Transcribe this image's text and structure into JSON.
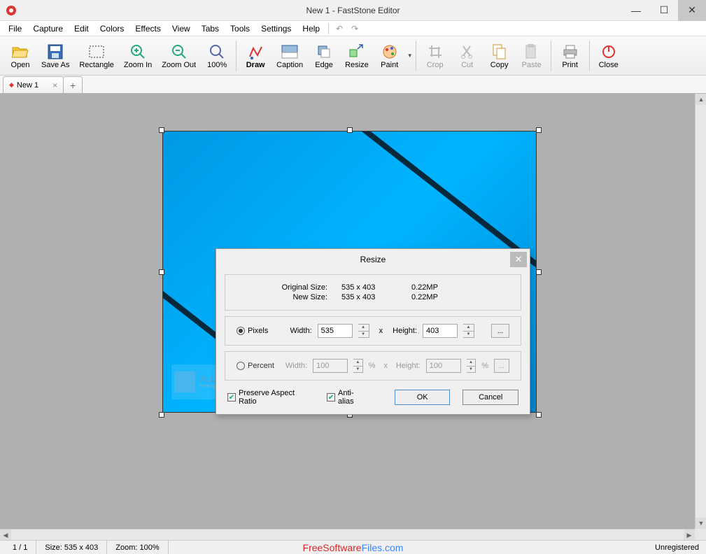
{
  "window": {
    "title": "New 1 - FastStone Editor"
  },
  "menu": [
    "File",
    "Capture",
    "Edit",
    "Colors",
    "Effects",
    "View",
    "Tabs",
    "Tools",
    "Settings",
    "Help"
  ],
  "toolbar": [
    {
      "label": "Open",
      "icon": "open-icon",
      "enabled": true
    },
    {
      "label": "Save As",
      "icon": "save-icon",
      "enabled": true
    },
    {
      "label": "Rectangle",
      "icon": "rect-icon",
      "enabled": true
    },
    {
      "label": "Zoom In",
      "icon": "zoomin-icon",
      "enabled": true
    },
    {
      "label": "Zoom Out",
      "icon": "zoomout-icon",
      "enabled": true
    },
    {
      "label": "100%",
      "icon": "zoom100-icon",
      "enabled": true
    }
  ],
  "toolbar2": [
    {
      "label": "Draw",
      "icon": "draw-icon",
      "bold": true,
      "enabled": true
    },
    {
      "label": "Caption",
      "icon": "caption-icon",
      "enabled": true
    },
    {
      "label": "Edge",
      "icon": "edge-icon",
      "enabled": true
    },
    {
      "label": "Resize",
      "icon": "resize-icon",
      "enabled": true
    },
    {
      "label": "Paint",
      "icon": "paint-icon",
      "enabled": true,
      "dropdown": true
    }
  ],
  "toolbar3": [
    {
      "label": "Crop",
      "icon": "crop-icon",
      "enabled": false
    },
    {
      "label": "Cut",
      "icon": "cut-icon",
      "enabled": false
    },
    {
      "label": "Copy",
      "icon": "copy-icon",
      "enabled": true
    },
    {
      "label": "Paste",
      "icon": "paste-icon",
      "enabled": false
    }
  ],
  "toolbar4": [
    {
      "label": "Print",
      "icon": "print-icon",
      "enabled": true
    },
    {
      "label": "Close",
      "icon": "close-icon",
      "enabled": true
    }
  ],
  "tabs": {
    "active_label": "New 1"
  },
  "watermark": {
    "title": "ALL PC World",
    "sub": "Free Apps One Click Away"
  },
  "status": {
    "page": "1 / 1",
    "size": "Size: 535 x 403",
    "zoom": "Zoom: 100%",
    "site_a": "FreeSoftware",
    "site_b": "Files.com",
    "unreg": "Unregistered"
  },
  "dialog": {
    "title": "Resize",
    "orig_label": "Original Size:",
    "orig_val": "535 x 403",
    "orig_mp": "0.22MP",
    "new_label": "New Size:",
    "new_val": "535 x 403",
    "new_mp": "0.22MP",
    "pixels_label": "Pixels",
    "width_label": "Width:",
    "width_val": "535",
    "x_label": "x",
    "height_label": "Height:",
    "height_val": "403",
    "percent_label": "Percent",
    "pwidth_val": "100",
    "pheight_val": "100",
    "percent_sym": "%",
    "preserve_label": "Preserve Aspect Ratio",
    "aa_label": "Anti-alias",
    "ok": "OK",
    "cancel": "Cancel",
    "more": "..."
  }
}
